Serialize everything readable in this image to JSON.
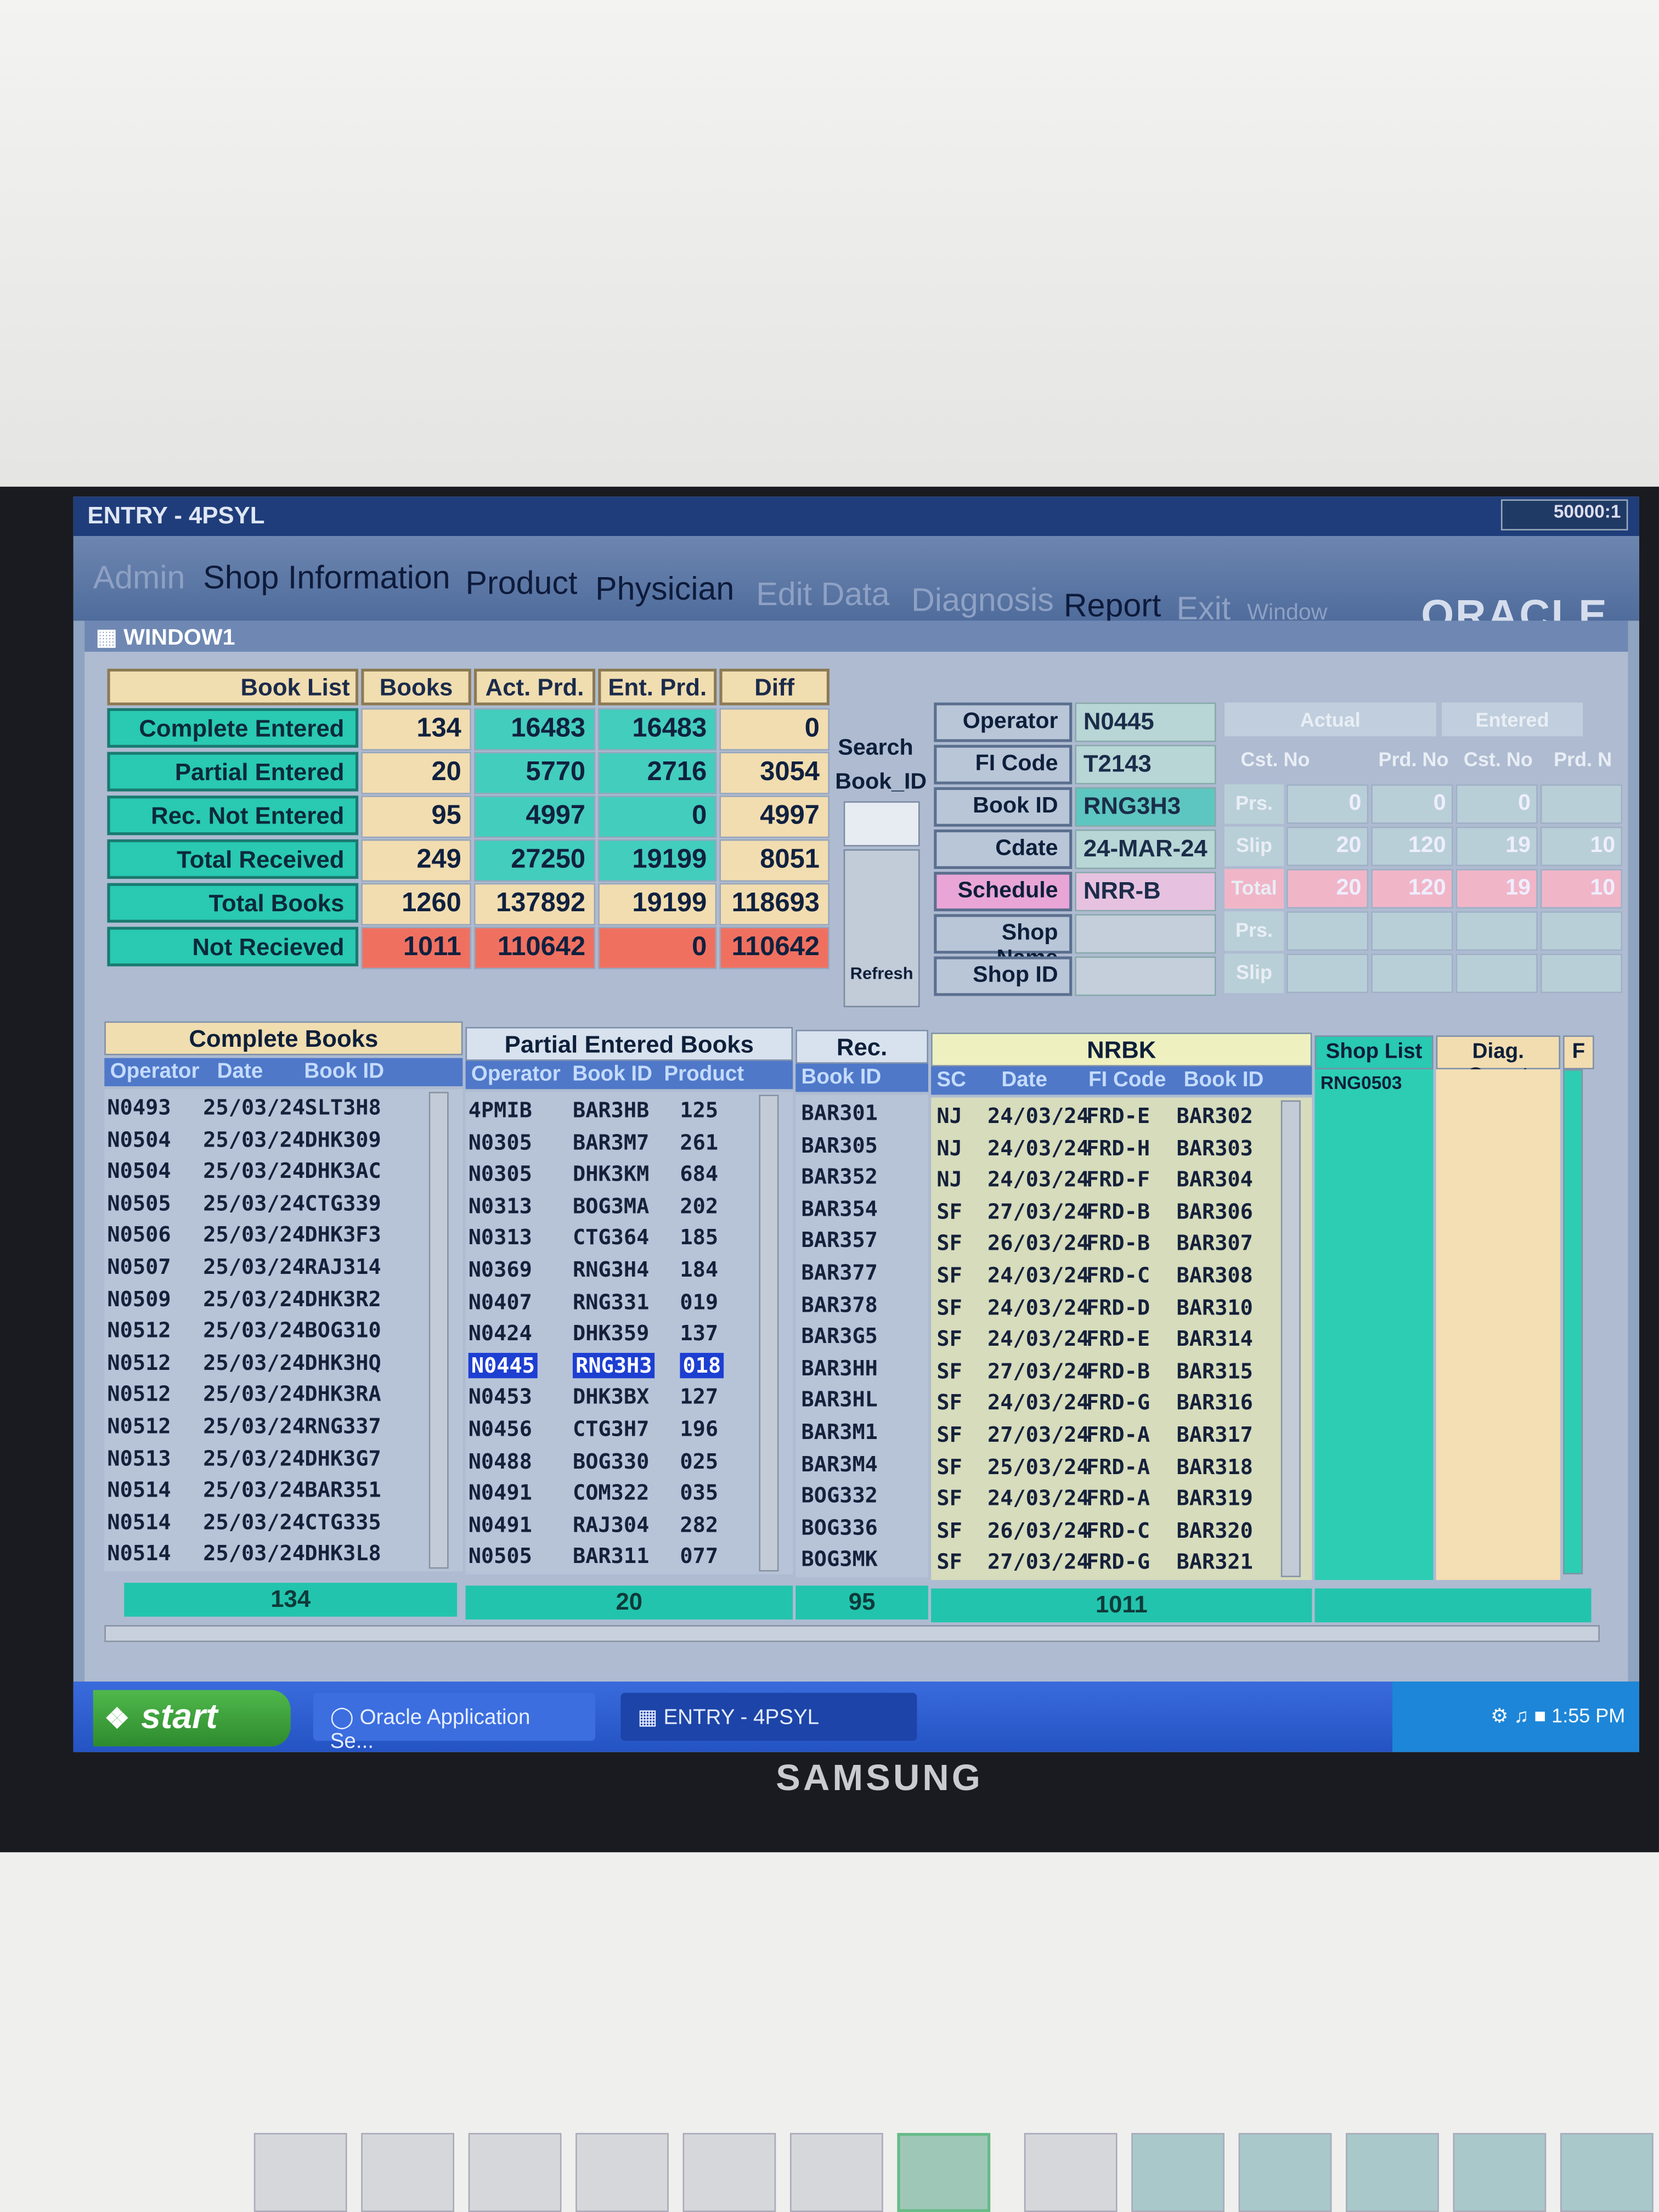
{
  "window": {
    "title": "ENTRY - 4PSYL",
    "badge": "50000:1",
    "subwindow": "WINDOW1",
    "brand": "ORACLE"
  },
  "menu": [
    "Admin",
    "Shop Information",
    "Product",
    "Physician",
    "Edit Data",
    "Diagnosis",
    "Report",
    "Exit",
    "Window"
  ],
  "summary": {
    "headers": [
      "Book List",
      "Books",
      "Act. Prd.",
      "Ent. Prd.",
      "Diff"
    ],
    "rows": [
      {
        "label": "Complete Entered",
        "books": "134",
        "act": "16483",
        "ent": "16483",
        "diff": "0"
      },
      {
        "label": "Partial Entered",
        "books": "20",
        "act": "5770",
        "ent": "2716",
        "diff": "3054"
      },
      {
        "label": "Rec. Not Entered",
        "books": "95",
        "act": "4997",
        "ent": "0",
        "diff": "4997"
      },
      {
        "label": "Total Received",
        "books": "249",
        "act": "27250",
        "ent": "19199",
        "diff": "8051"
      },
      {
        "label": "Total Books",
        "books": "1260",
        "act": "137892",
        "ent": "19199",
        "diff": "118693"
      },
      {
        "label": "Not Recieved",
        "books": "1011",
        "act": "110642",
        "ent": "0",
        "diff": "110642"
      }
    ]
  },
  "search": {
    "label1": "Search",
    "label2": "Book_ID",
    "refresh": "Refresh"
  },
  "details": {
    "operator_label": "Operator",
    "operator": "N0445",
    "fi_label": "FI Code",
    "fi": "T2143",
    "book_label": "Book ID",
    "book": "RNG3H3",
    "cdate_label": "Cdate",
    "cdate": "24-MAR-24",
    "schedule_label": "Schedule",
    "schedule": "NRR-B",
    "shopname_label": "Shop Name",
    "shopid_label": "Shop ID",
    "actual_label": "Actual",
    "entered_label": "Entered",
    "sub_headers": [
      "Cst. No",
      "Prd. No",
      "Cst. No",
      "Prd. N"
    ],
    "prs": "Prs.",
    "slip": "Slip",
    "total": "Total",
    "prs_vals": [
      "0",
      "0",
      "0",
      ""
    ],
    "slip_vals": [
      "20",
      "120",
      "19",
      "10"
    ],
    "total_vals": [
      "20",
      "120",
      "19",
      "10"
    ]
  },
  "tabs": {
    "complete": "Complete Books",
    "partial": "Partial Entered Books",
    "rec": "Rec. NEBK",
    "nrbk": "NRBK",
    "shoplist": "Shop List",
    "diag": "Diag. Count",
    "f": "F"
  },
  "col_headers": {
    "complete": [
      "Operator",
      "Date",
      "Book ID"
    ],
    "partial": [
      "Operator",
      "Book ID",
      "Product"
    ],
    "rec": [
      "Book ID"
    ],
    "nrbk": [
      "SC",
      "Date",
      "FI Code",
      "Book ID"
    ],
    "shoplist": [
      "RNG0503"
    ]
  },
  "complete_books": [
    [
      "N0493",
      "25/03/24",
      "SLT3H8"
    ],
    [
      "N0504",
      "25/03/24",
      "DHK309"
    ],
    [
      "N0504",
      "25/03/24",
      "DHK3AC"
    ],
    [
      "N0505",
      "25/03/24",
      "CTG339"
    ],
    [
      "N0506",
      "25/03/24",
      "DHK3F3"
    ],
    [
      "N0507",
      "25/03/24",
      "RAJ314"
    ],
    [
      "N0509",
      "25/03/24",
      "DHK3R2"
    ],
    [
      "N0512",
      "25/03/24",
      "BOG310"
    ],
    [
      "N0512",
      "25/03/24",
      "DHK3HQ"
    ],
    [
      "N0512",
      "25/03/24",
      "DHK3RA"
    ],
    [
      "N0512",
      "25/03/24",
      "RNG337"
    ],
    [
      "N0513",
      "25/03/24",
      "DHK3G7"
    ],
    [
      "N0514",
      "25/03/24",
      "BAR351"
    ],
    [
      "N0514",
      "25/03/24",
      "CTG335"
    ],
    [
      "N0514",
      "25/03/24",
      "DHK3L8"
    ]
  ],
  "partial_books": [
    [
      "4PMIB",
      "BAR3HB",
      "125"
    ],
    [
      "N0305",
      "BAR3M7",
      "261"
    ],
    [
      "N0305",
      "DHK3KM",
      "684"
    ],
    [
      "N0313",
      "BOG3MA",
      "202"
    ],
    [
      "N0313",
      "CTG364",
      "185"
    ],
    [
      "N0369",
      "RNG3H4",
      "184"
    ],
    [
      "N0407",
      "RNG331",
      "019"
    ],
    [
      "N0424",
      "DHK359",
      "137"
    ],
    [
      "N0445",
      "RNG3H3",
      "018"
    ],
    [
      "N0453",
      "DHK3BX",
      "127"
    ],
    [
      "N0456",
      "CTG3H7",
      "196"
    ],
    [
      "N0488",
      "BOG330",
      "025"
    ],
    [
      "N0491",
      "COM322",
      "035"
    ],
    [
      "N0491",
      "RAJ304",
      "282"
    ],
    [
      "N0505",
      "BAR311",
      "077"
    ]
  ],
  "rec_nebk": [
    "BAR301",
    "BAR305",
    "BAR352",
    "BAR354",
    "BAR357",
    "BAR377",
    "BAR378",
    "BAR3G5",
    "BAR3HH",
    "BAR3HL",
    "BAR3M1",
    "BAR3M4",
    "BOG332",
    "BOG336",
    "BOG3MK"
  ],
  "nrbk": [
    [
      "NJ",
      "24/03/24",
      "FRD-E",
      "BAR302"
    ],
    [
      "NJ",
      "24/03/24",
      "FRD-H",
      "BAR303"
    ],
    [
      "NJ",
      "24/03/24",
      "FRD-F",
      "BAR304"
    ],
    [
      "SF",
      "27/03/24",
      "FRD-B",
      "BAR306"
    ],
    [
      "SF",
      "26/03/24",
      "FRD-B",
      "BAR307"
    ],
    [
      "SF",
      "24/03/24",
      "FRD-C",
      "BAR308"
    ],
    [
      "SF",
      "24/03/24",
      "FRD-D",
      "BAR310"
    ],
    [
      "SF",
      "24/03/24",
      "FRD-E",
      "BAR314"
    ],
    [
      "SF",
      "27/03/24",
      "FRD-B",
      "BAR315"
    ],
    [
      "SF",
      "24/03/24",
      "FRD-G",
      "BAR316"
    ],
    [
      "SF",
      "27/03/24",
      "FRD-A",
      "BAR317"
    ],
    [
      "SF",
      "25/03/24",
      "FRD-A",
      "BAR318"
    ],
    [
      "SF",
      "24/03/24",
      "FRD-A",
      "BAR319"
    ],
    [
      "SF",
      "26/03/24",
      "FRD-C",
      "BAR320"
    ],
    [
      "SF",
      "27/03/24",
      "FRD-G",
      "BAR321"
    ]
  ],
  "totals": {
    "complete": "134",
    "partial": "20",
    "rec": "95",
    "nrbk": "1011"
  },
  "taskbar": {
    "start": "start",
    "item1": "Oracle Application Se...",
    "item2": "ENTRY - 4PSYL",
    "clock": "1:55 PM"
  },
  "monitor": {
    "brand": "SAMSUNG"
  },
  "colors": {
    "teal": "#29c9b2",
    "tan": "#f2ddb0",
    "red": "#f07060",
    "selection": "#1d3fd2",
    "menubar": "#4f6c9c"
  }
}
